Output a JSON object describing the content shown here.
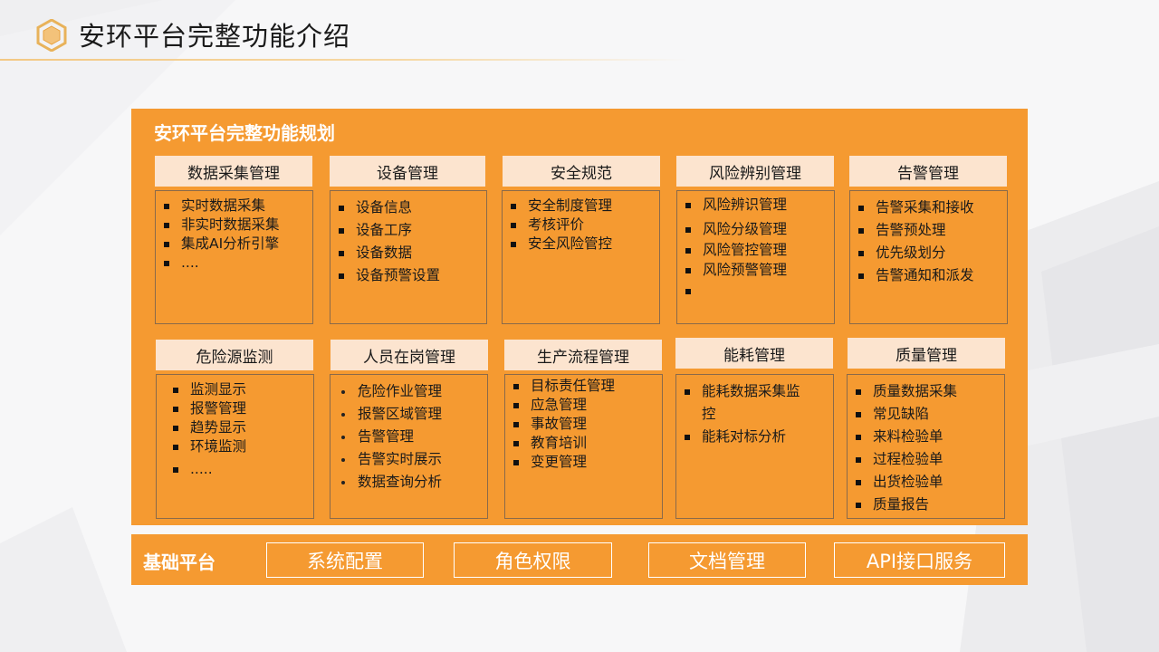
{
  "header": {
    "title": "安环平台完整功能介绍",
    "logo_icon": "hexagon-logo-icon"
  },
  "panel": {
    "title": "安环平台完整功能规划",
    "modules": [
      {
        "id": "data-collection",
        "title": "数据采集管理",
        "bullet": "square",
        "items": [
          "实时数据采集",
          "非实时数据采集",
          "集成AI分析引擎",
          "...."
        ]
      },
      {
        "id": "equipment",
        "title": "设备管理",
        "bullet": "square",
        "items": [
          "设备信息",
          "设备工序",
          "设备数据",
          "设备预警设置"
        ]
      },
      {
        "id": "safety-norms",
        "title": "安全规范",
        "bullet": "square",
        "items": [
          "安全制度管理",
          "考核评价",
          "安全风险管控"
        ]
      },
      {
        "id": "risk-identification",
        "title": "风险辨别管理",
        "bullet": "square",
        "items": [
          "风险辨识管理",
          "风险分级管理",
          "风险管控管理",
          "风险预警管理",
          ""
        ]
      },
      {
        "id": "alarm",
        "title": "告警管理",
        "bullet": "square",
        "items": [
          "告警采集和接收",
          "告警预处理",
          "优先级划分",
          "告警通知和派发"
        ]
      },
      {
        "id": "hazard-monitoring",
        "title": "危险源监测",
        "bullet": "square",
        "items": [
          "监测显示",
          "报警管理",
          "趋势显示",
          "环境监测",
          "....."
        ]
      },
      {
        "id": "personnel",
        "title": "人员在岗管理",
        "bullet": "dot",
        "items": [
          "危险作业管理",
          "报警区域管理",
          "告警管理",
          "告警实时展示",
          "数据查询分析"
        ]
      },
      {
        "id": "production-flow",
        "title": "生产流程管理",
        "bullet": "square",
        "items": [
          "目标责任管理",
          "应急管理",
          "事故管理",
          "教育培训",
          "变更管理"
        ]
      },
      {
        "id": "energy",
        "title": "能耗管理",
        "bullet": "square",
        "items": [
          "能耗数据采集监控",
          "能耗对标分析"
        ]
      },
      {
        "id": "quality",
        "title": "质量管理",
        "bullet": "square",
        "items": [
          "质量数据采集",
          "常见缺陷",
          "来料检验单",
          "过程检验单",
          "出货检验单",
          "质量报告"
        ]
      }
    ]
  },
  "base": {
    "label": "基础平台",
    "buttons": [
      "系统配置",
      "角色权限",
      "文档管理",
      "API接口服务"
    ]
  },
  "colors": {
    "accent_orange": "#f59a31",
    "header_cell": "#fce4cf",
    "background": "#f7f7f8",
    "logo_gold": "#e8b25a"
  }
}
